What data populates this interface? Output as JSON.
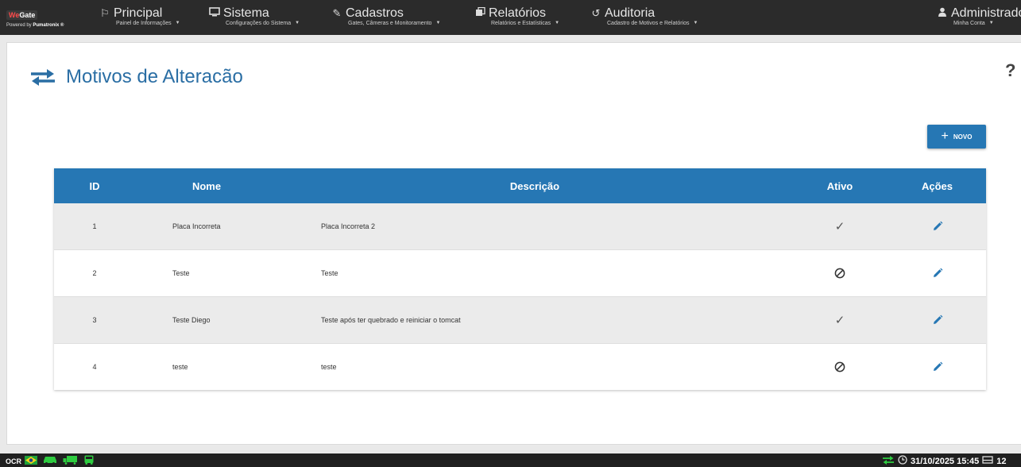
{
  "app": {
    "logo_we": "We",
    "logo_gate": "Gate",
    "powered_prefix": "Powered by ",
    "powered_brand": "Pumatronix ®"
  },
  "nav": [
    {
      "icon": "flag-icon",
      "label": "Principal",
      "sub": "Painel de Informações"
    },
    {
      "icon": "monitor-icon",
      "label": "Sistema",
      "sub": "Configurações do Sistema"
    },
    {
      "icon": "edit-square-icon",
      "label": "Cadastros",
      "sub": "Gates, Câmeras e Monitoramento"
    },
    {
      "icon": "reports-icon",
      "label": "Relatórios",
      "sub": "Relatórios e Estatísticas"
    },
    {
      "icon": "history-icon",
      "label": "Auditoria",
      "sub": "Cadastro de Motivos e Relatórios"
    }
  ],
  "user": {
    "label": "Administrador",
    "sub": "Minha Conta"
  },
  "page": {
    "title": "Motivos de Alteracão"
  },
  "actions": {
    "novo_label": "NOVO"
  },
  "table": {
    "headers": {
      "id": "ID",
      "nome": "Nome",
      "descricao": "Descrição",
      "ativo": "Ativo",
      "acoes": "Ações"
    },
    "rows": [
      {
        "id": "1",
        "nome": "Placa Incorreta",
        "descricao": "Placa Incorreta 2",
        "ativo": true
      },
      {
        "id": "2",
        "nome": "Teste",
        "descricao": "Teste",
        "ativo": false
      },
      {
        "id": "3",
        "nome": "Teste Diego",
        "descricao": "Teste após ter quebrado e reiniciar o tomcat",
        "ativo": true
      },
      {
        "id": "4",
        "nome": "teste",
        "descricao": "teste",
        "ativo": false
      }
    ]
  },
  "status": {
    "left_label": "OCR",
    "left_icons": [
      "brazil-flag-icon",
      "car-icon",
      "truck-icon",
      "bus-icon"
    ],
    "datetime": "31/10/2025 15:45",
    "trailing": "12"
  },
  "colors": {
    "accent": "#2677b4",
    "title": "#2a6ea4",
    "topbar": "#2b2b2b",
    "status_icon_green": "#2ecc40"
  }
}
